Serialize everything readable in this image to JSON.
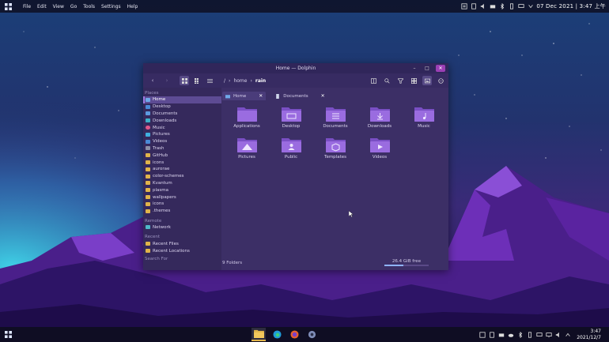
{
  "menubar": {
    "items": [
      "File",
      "Edit",
      "View",
      "Go",
      "Tools",
      "Settings",
      "Help"
    ]
  },
  "clock": {
    "top": "07 Dec 2021 | 3:47 上午",
    "time": "3:47",
    "date": "2021/12/7"
  },
  "window": {
    "title": "Home — Dolphin",
    "min": "–",
    "max": "□",
    "close": "✕"
  },
  "breadcrumb": {
    "root": "/",
    "home": "home",
    "current": "rain"
  },
  "tabs": [
    {
      "label": "Home"
    },
    {
      "label": "Documents"
    }
  ],
  "tab_close": "✕",
  "sidebar": {
    "places_label": "Places",
    "places": [
      "Home",
      "Desktop",
      "Documents",
      "Downloads",
      "Music",
      "Pictures",
      "Videos",
      "Trash",
      "GitHub",
      "icons",
      "aurorae",
      "color-schemes",
      "Kvantum",
      "plasma",
      "wallpapers",
      "icons",
      ".themes"
    ],
    "remote_label": "Remote",
    "remote": [
      "Network"
    ],
    "recent_label": "Recent",
    "recent": [
      "Recent Files",
      "Recent Locations"
    ],
    "search_label": "Search For"
  },
  "folders": [
    "Applications",
    "Desktop",
    "Documents",
    "Downloads",
    "Music",
    "Pictures",
    "Public",
    "Templates",
    "Videos"
  ],
  "status": {
    "count": "9 Folders",
    "free": "26.4 GiB free",
    "free_used_fraction": 0.42
  },
  "colors": {
    "accent": "#9b3fb5",
    "folder": "#8e5fd0",
    "selection": "#5d4b93"
  }
}
